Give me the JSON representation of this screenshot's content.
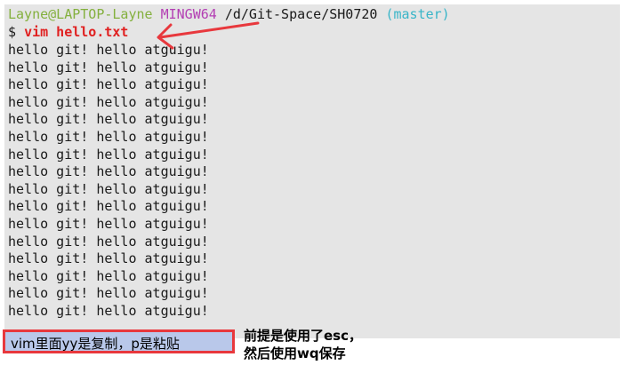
{
  "terminal": {
    "prompt": {
      "user_host": "Layne@LAPTOP-Layne",
      "system": "MINGW64",
      "path": "/d/Git-Space/SH0720",
      "branch": "(master)"
    },
    "command": {
      "symbol": "$",
      "text": "vim hello.txt"
    },
    "output_lines": [
      "hello git! hello atguigu!",
      "hello git! hello atguigu!",
      "hello git! hello atguigu!",
      "hello git! hello atguigu!",
      "hello git! hello atguigu!",
      "hello git! hello atguigu!",
      "hello git! hello atguigu!",
      "hello git! hello atguigu!",
      "hello git! hello atguigu!",
      "hello git! hello atguigu!",
      "hello git! hello atguigu!",
      "hello git! hello atguigu!",
      "hello git! hello atguigu!",
      "hello git! hello atguigu!",
      "hello git! hello atguigu!",
      "hello git! hello atguigu!"
    ]
  },
  "annotations": {
    "boxed_note": "vim里面yy是复制，p是粘贴",
    "side_note_line1": "前提是使用了esc，",
    "side_note_line2": "然后使用wq保存"
  },
  "colors": {
    "terminal_bg": "#e5e5e5",
    "user_host": "#84b03e",
    "system": "#b33fb3",
    "branch": "#38b5c8",
    "command": "#e02020",
    "annotation_border": "#e8383d",
    "annotation_fill": "#b9c8ea"
  }
}
